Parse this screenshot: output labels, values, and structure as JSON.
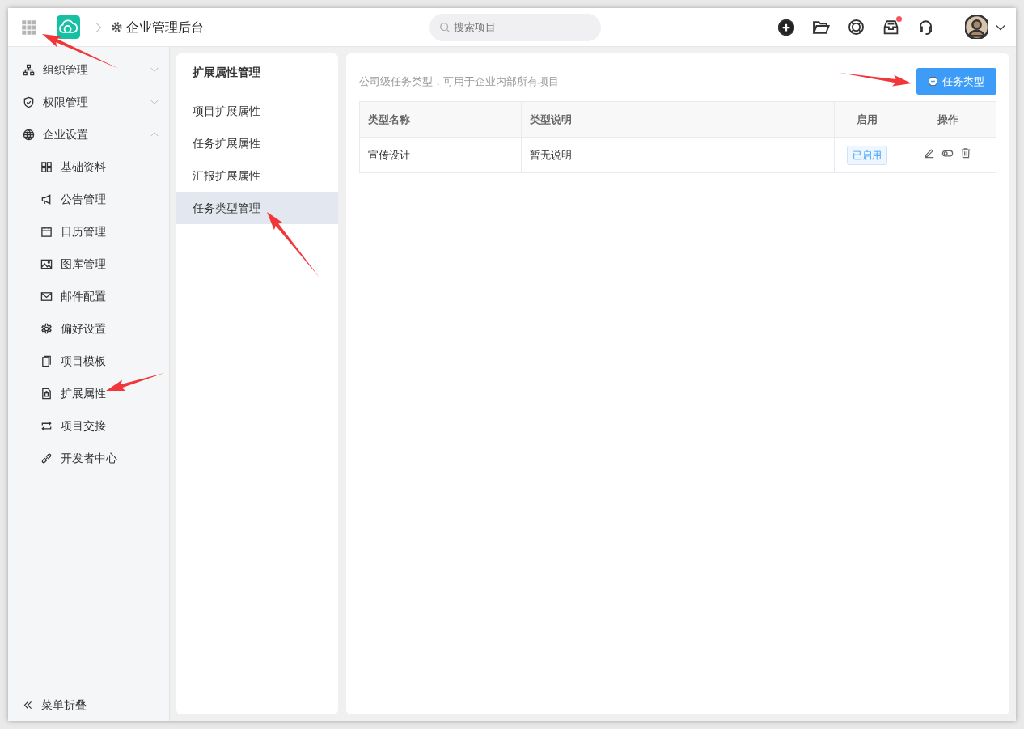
{
  "header": {
    "title": "企业管理后台",
    "search": {
      "placeholder": "搜索项目"
    },
    "notification_dot": true
  },
  "sidebar": {
    "items": [
      {
        "label": "组织管理",
        "kind": "org",
        "expanded": false
      },
      {
        "label": "权限管理",
        "kind": "shield",
        "expanded": false
      },
      {
        "label": "企业设置",
        "kind": "globe",
        "expanded": true,
        "children": [
          {
            "label": "基础资料",
            "kind": "grid"
          },
          {
            "label": "公告管理",
            "kind": "megaphone"
          },
          {
            "label": "日历管理",
            "kind": "calendar"
          },
          {
            "label": "图库管理",
            "kind": "image"
          },
          {
            "label": "邮件配置",
            "kind": "mail"
          },
          {
            "label": "偏好设置",
            "kind": "gear"
          },
          {
            "label": "项目模板",
            "kind": "copy"
          },
          {
            "label": "扩展属性",
            "kind": "file"
          },
          {
            "label": "项目交接",
            "kind": "swap"
          },
          {
            "label": "开发者中心",
            "kind": "link"
          }
        ]
      }
    ],
    "collapse_label": "菜单折叠"
  },
  "subnav": {
    "title": "扩展属性管理",
    "items": [
      {
        "label": "项目扩展属性",
        "selected": false
      },
      {
        "label": "任务扩展属性",
        "selected": false
      },
      {
        "label": "汇报扩展属性",
        "selected": false
      },
      {
        "label": "任务类型管理",
        "selected": true
      }
    ]
  },
  "main": {
    "description": "公司级任务类型，可用于企业内部所有项目",
    "add_button": "任务类型",
    "table": {
      "columns": [
        "类型名称",
        "类型说明",
        "启用",
        "操作"
      ],
      "rows": [
        {
          "name": "宣传设计",
          "description": "暂无说明",
          "status": "已启用",
          "enabled": true
        }
      ]
    }
  }
}
